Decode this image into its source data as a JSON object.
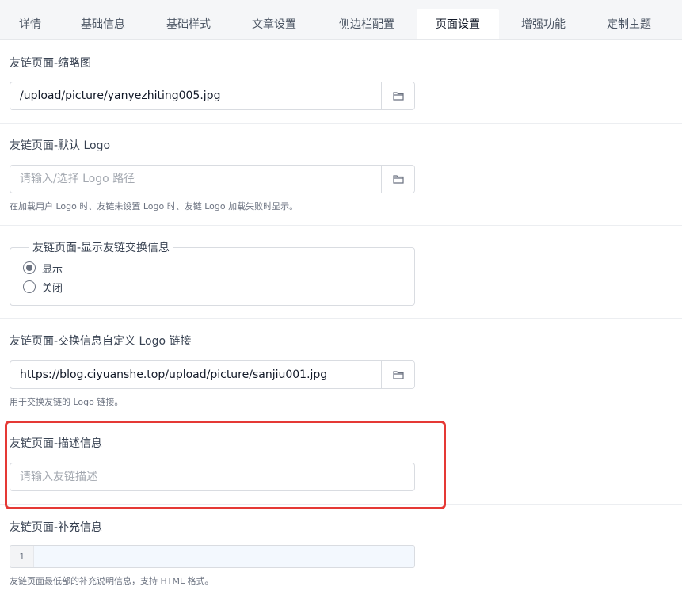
{
  "tabs": [
    {
      "label": "详情"
    },
    {
      "label": "基础信息"
    },
    {
      "label": "基础样式"
    },
    {
      "label": "文章设置"
    },
    {
      "label": "侧边栏配置"
    },
    {
      "label": "页面设置"
    },
    {
      "label": "增强功能"
    },
    {
      "label": "定制主题"
    }
  ],
  "active_tab": "页面设置",
  "thumbnail": {
    "label": "友链页面-缩略图",
    "value": "/upload/picture/yanyezhiting005.jpg",
    "icon": "folder-icon"
  },
  "default_logo": {
    "label": "友链页面-默认 Logo",
    "placeholder": "请输入/选择 Logo 路径",
    "value": "",
    "help": "在加载用户 Logo 时、友链未设置 Logo 时、友链 Logo 加载失败时显示。",
    "icon": "folder-icon"
  },
  "exchange_info": {
    "label": "友链页面-显示友链交换信息",
    "options": [
      {
        "label": "显示",
        "checked": true
      },
      {
        "label": "关闭",
        "checked": false
      }
    ]
  },
  "custom_logo": {
    "label": "友链页面-交换信息自定义 Logo 链接",
    "value": "https://blog.ciyuanshe.top/upload/picture/sanjiu001.jpg",
    "help": "用于交换友链的 Logo 链接。",
    "icon": "folder-icon"
  },
  "description": {
    "label": "友链页面-描述信息",
    "placeholder": "请输入友链描述",
    "value": ""
  },
  "supplement": {
    "label": "友链页面-补充信息",
    "line_number": "1",
    "help": "友链页面最低部的补充说明信息，支持 HTML 格式。"
  },
  "colors": {
    "highlight": "#e53935",
    "tab_bar": "#f5f6f8"
  }
}
